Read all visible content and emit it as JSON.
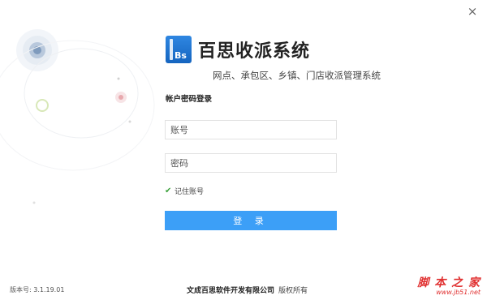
{
  "window": {
    "close_icon": "close-icon",
    "close_glyph": "×"
  },
  "brand": {
    "logo_icon": "bs-logo-icon",
    "logo_text": "Bs",
    "title": "百思收派系统"
  },
  "subtitle": "网点、承包区、乡镇、门店收派管理系统",
  "login": {
    "tab_title": "帐户密码登录",
    "username_placeholder": "账号",
    "password_placeholder": "密码",
    "remember_label": "记住账号",
    "remember_checked": true,
    "submit_label": "登 录"
  },
  "footer": {
    "version": "版本号: 3.1.19.01",
    "company": "文成百思软件开发有限公司",
    "rights": "版权所有"
  },
  "watermark": {
    "cn": "脚 本 之 家",
    "url": "www.jb51.net"
  },
  "colors": {
    "accent": "#3c9ff7",
    "logo": "#1f75d0",
    "check": "#3aa03a",
    "watermark": "#e03030"
  }
}
